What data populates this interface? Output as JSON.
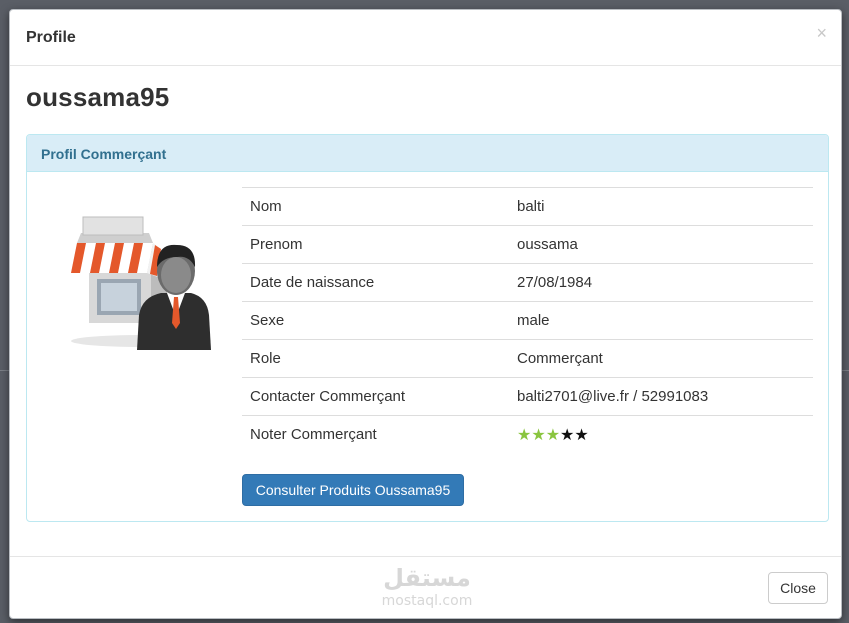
{
  "modal": {
    "title": "Profile",
    "close_symbol": "×",
    "username": "oussama95"
  },
  "panel": {
    "heading": "Profil Commerçant",
    "image_icon": "merchant-shop-person-icon",
    "rows": [
      {
        "label": "Nom",
        "value": "balti"
      },
      {
        "label": "Prenom",
        "value": "oussama"
      },
      {
        "label": "Date de naissance",
        "value": "27/08/1984"
      },
      {
        "label": "Sexe",
        "value": "male"
      },
      {
        "label": "Role",
        "value": "Commerçant"
      },
      {
        "label": "Contacter Commerçant",
        "value": "balti2701@live.fr / 52991083"
      }
    ],
    "rating": {
      "label": "Noter Commerçant",
      "value": 3,
      "max": 5,
      "star_symbol": "★",
      "active_color": "#8ac53f",
      "inactive_color": "#111111"
    },
    "products_button": "Consulter Produits Oussama95"
  },
  "footer": {
    "close_button": "Close",
    "watermark_arabic": "مستقل",
    "watermark_latin": "mostaql.com"
  },
  "colors": {
    "primary": "#337ab7",
    "panel_heading_bg": "#d9edf7",
    "panel_heading_text": "#31708f",
    "panel_border": "#bce8f1"
  }
}
